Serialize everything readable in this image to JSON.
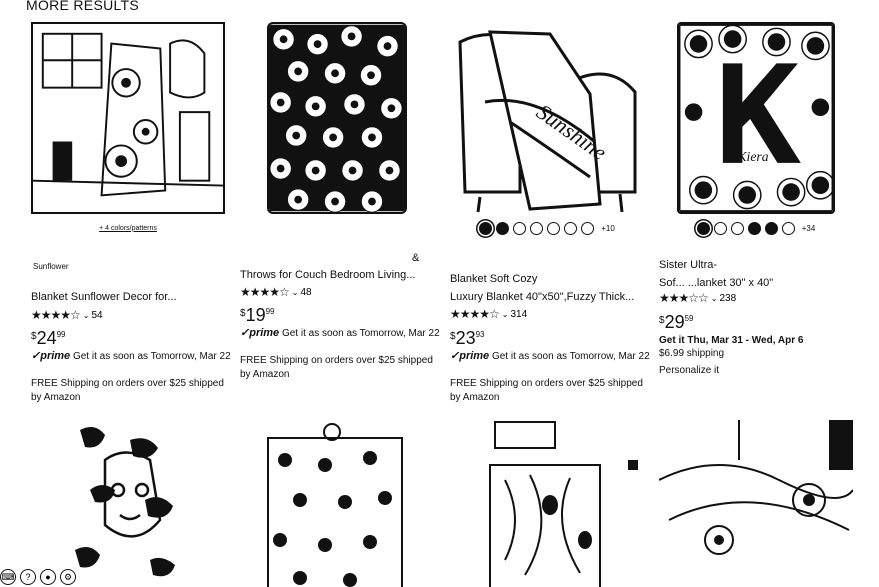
{
  "section": {
    "title": "MORE RESULTS"
  },
  "products": [
    {
      "brand": "Sunflower",
      "colors_link": "+ 4 colors/patterns",
      "title_lines": [
        "",
        "Blanket Sunflower Decor for..."
      ],
      "rating_count": "54",
      "price_whole": "24",
      "price_frac": "99",
      "prime_label": "prime",
      "delivery": "Get it as soon as Tomorrow, Mar 22",
      "shipping": "FREE Shipping on orders over $25 shipped by Amazon"
    },
    {
      "brand": "&",
      "title_lines": [
        "Throws for Couch Bedroom Living..."
      ],
      "rating_count": "48",
      "price_whole": "19",
      "price_frac": "99",
      "prime_label": "prime",
      "delivery": "Get it as soon as Tomorrow, Mar 22",
      "shipping": "FREE Shipping on orders over $25 shipped by Amazon"
    },
    {
      "title_lines": [
        "Blanket Soft Cozy",
        "Luxury Blanket 40\"x50\",Fuzzy Thick..."
      ],
      "more_swatches": "+10",
      "rating_count": "314",
      "price_whole": "23",
      "price_frac": "93",
      "prime_label": "prime",
      "delivery": "Get it as soon as Tomorrow, Mar 22",
      "shipping": "FREE Shipping on orders over $25 shipped by Amazon"
    },
    {
      "title_lines": [
        "Sister Ultra-",
        "Sof... ...lanket 30\" x 40\""
      ],
      "more_swatches": "+34",
      "rating_count": "238",
      "price_whole": "29",
      "price_frac": "59",
      "delivery": "Get it Thu, Mar 31 - Wed, Apr 6",
      "shipping_cost": "$6.99 shipping",
      "personalize": "Personalize it"
    }
  ],
  "icons": {
    "star_full": "★",
    "star_empty": "☆",
    "chevron": "⌄",
    "prime_check": "✓"
  }
}
